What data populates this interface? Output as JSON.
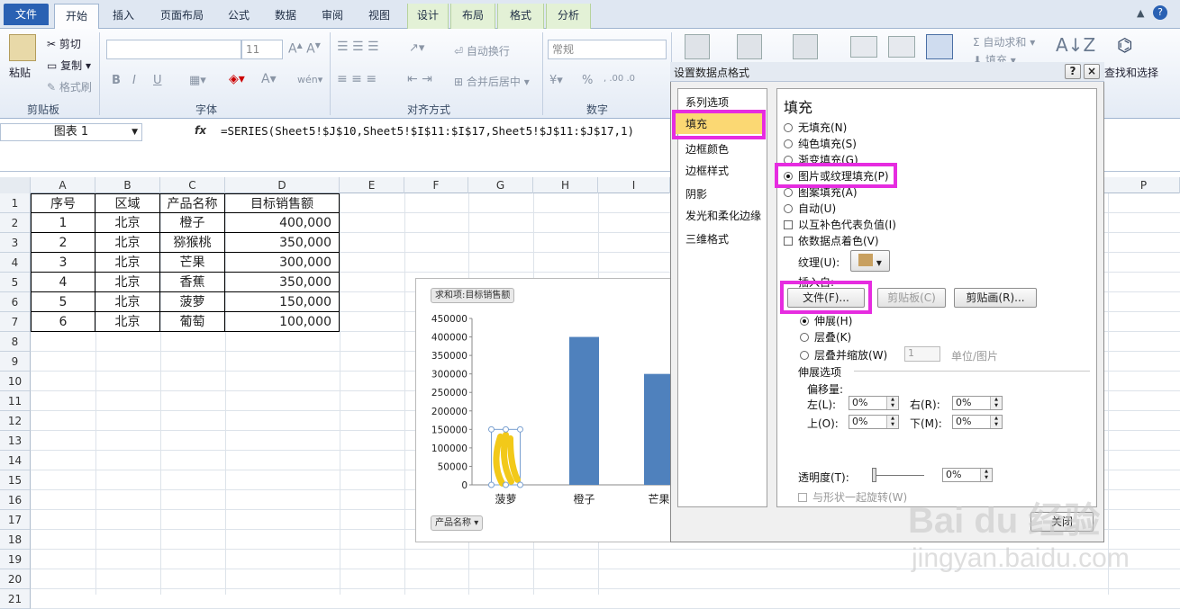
{
  "tabs": [
    "文件",
    "开始",
    "插入",
    "页面布局",
    "公式",
    "数据",
    "审阅",
    "视图",
    "设计",
    "布局",
    "格式",
    "分析"
  ],
  "ribbon": {
    "paste": "粘贴",
    "cut": "剪切",
    "copy": "复制",
    "format_painter": "格式刷",
    "font_size": "11",
    "bold": "B",
    "italic": "I",
    "underline": "U",
    "wrap": "自动换行",
    "merge": "合并后居中",
    "number_format": "常规",
    "percent": "%",
    "autosum": "自动求和",
    "fill": "填充",
    "find_select": "查找和选择",
    "groups": [
      "剪贴板",
      "字体",
      "对齐方式",
      "数字"
    ]
  },
  "namebox": "图表 1",
  "formula_icon": "fx",
  "formula": "=SERIES(Sheet5!$J$10,Sheet5!$I$11:$I$17,Sheet5!$J$11:$J$17,1)",
  "columns": [
    "A",
    "B",
    "C",
    "D",
    "E",
    "F",
    "G",
    "H",
    "I",
    "P"
  ],
  "rows": [
    "1",
    "2",
    "3",
    "4",
    "5",
    "6",
    "7",
    "8",
    "9",
    "10",
    "11",
    "12",
    "13",
    "14",
    "15",
    "16",
    "17",
    "18",
    "19",
    "20",
    "21"
  ],
  "table": {
    "headers": [
      "序号",
      "区域",
      "产品名称",
      "目标销售额"
    ],
    "rows": [
      [
        "1",
        "北京",
        "橙子",
        "400,000"
      ],
      [
        "2",
        "北京",
        "猕猴桃",
        "350,000"
      ],
      [
        "3",
        "北京",
        "芒果",
        "300,000"
      ],
      [
        "4",
        "北京",
        "香蕉",
        "350,000"
      ],
      [
        "5",
        "北京",
        "菠萝",
        "150,000"
      ],
      [
        "6",
        "北京",
        "葡萄",
        "100,000"
      ]
    ]
  },
  "chart_data": {
    "type": "bar",
    "categories": [
      "菠萝",
      "橙子",
      "芒果"
    ],
    "values": [
      150000,
      400000,
      300000
    ],
    "ylim": [
      0,
      450000
    ],
    "yticks": [
      "450000",
      "400000",
      "350000",
      "300000",
      "250000",
      "200000",
      "150000",
      "100000",
      "50000",
      "0"
    ],
    "series_label": "求和项:目标销售额",
    "axis_field": "产品名称",
    "bar_color": "#4f81bd"
  },
  "dialog": {
    "title": "设置数据点格式",
    "help": "?",
    "close": "×",
    "nav": [
      "系列选项",
      "填充",
      "边框颜色",
      "边框样式",
      "阴影",
      "发光和柔化边缘",
      "三维格式"
    ],
    "section": "填充",
    "fill_options": [
      "无填充(N)",
      "纯色填充(S)",
      "渐变填充(G)",
      "图片或纹理填充(P)",
      "图案填充(A)",
      "自动(U)"
    ],
    "invert": "以互补色代表负值(I)",
    "vary": "依数据点着色(V)",
    "texture": "纹理(U):",
    "insert_from": "插入自:",
    "file_btn": "文件(F)...",
    "clipboard_btn": "剪贴板(C)",
    "clipart_btn": "剪贴画(R)...",
    "stretch": "伸展(H)",
    "stack": "层叠(K)",
    "stack_scale": "层叠并缩放(W)",
    "stack_value": "1",
    "unit": "单位/图片",
    "stretch_options": "伸展选项",
    "offset": "偏移量:",
    "left": "左(L):",
    "right": "右(R):",
    "top": "上(O):",
    "bottom": "下(M):",
    "offset_val": "0%",
    "transparency": "透明度(T):",
    "transparency_val": "0%",
    "rotate": "与形状一起旋转(W)",
    "close_btn": "关闭"
  },
  "watermark": {
    "brand": "Bai du 经验",
    "url": "jingyan.baidu.com"
  }
}
